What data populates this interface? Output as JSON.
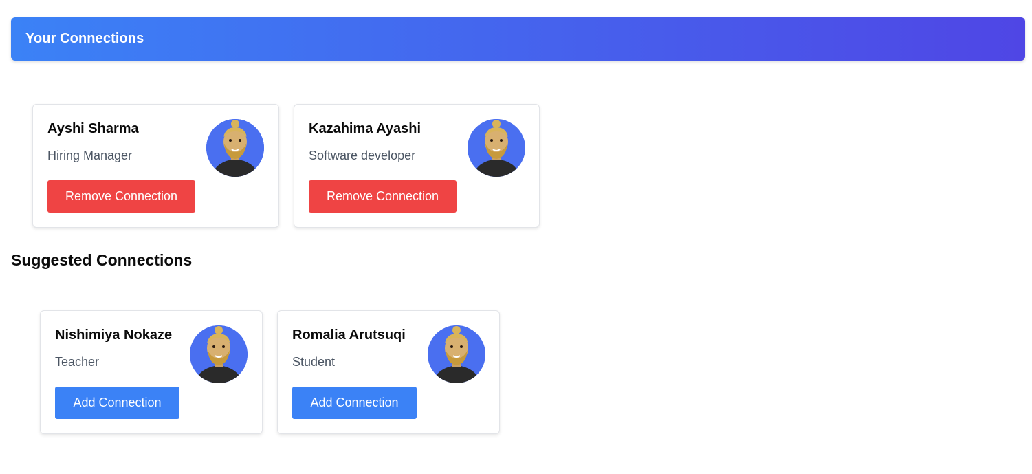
{
  "header": {
    "title": "Your Connections"
  },
  "connections": [
    {
      "name": "Ayshi Sharma",
      "role": "Hiring Manager",
      "button": "Remove Connection"
    },
    {
      "name": "Kazahima Ayashi",
      "role": "Software developer",
      "button": "Remove Connection"
    }
  ],
  "suggested": {
    "title": "Suggested Connections",
    "items": [
      {
        "name": "Nishimiya Nokaze",
        "role": "Teacher",
        "button": "Add Connection"
      },
      {
        "name": "Romalia Arutsuqi",
        "role": "Student",
        "button": "Add Connection"
      }
    ]
  },
  "colors": {
    "header_gradient_start": "#3b82f6",
    "header_gradient_end": "#4f46e5",
    "remove_button": "#ef4444",
    "add_button": "#3b82f6",
    "avatar_background": "#4a6ff0"
  },
  "icons": {
    "avatar": "avatar-3d-character"
  }
}
